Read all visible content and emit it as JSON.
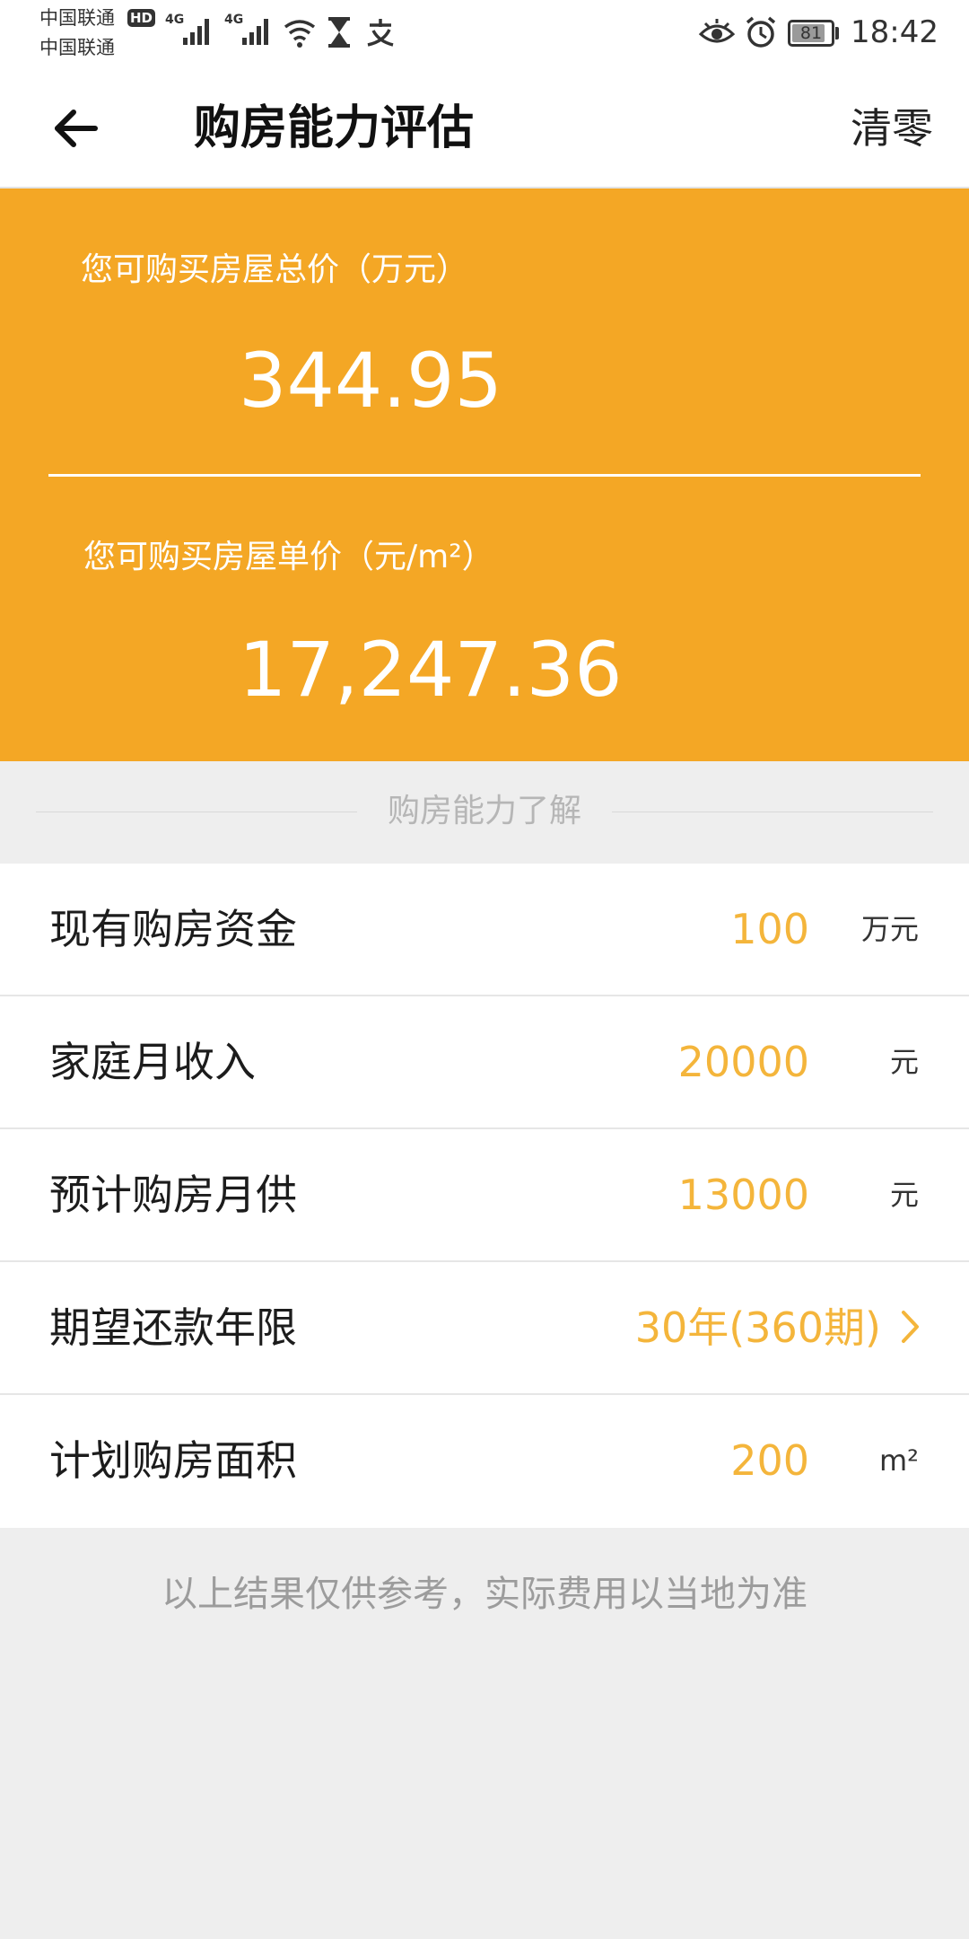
{
  "status_bar": {
    "carrier_1": "中国联通",
    "carrier_2": "中国联通",
    "hd_badge": "HD",
    "network_1": "4G",
    "network_2": "4G",
    "battery_level": "81",
    "time": "18:42"
  },
  "header": {
    "title": "购房能力评估",
    "clear_label": "清零"
  },
  "result": {
    "total_label": "您可购买房屋总价（万元）",
    "total_value": "344.95",
    "unit_label": "您可购买房屋单价（元/m²）",
    "unit_value": "17,247.36"
  },
  "section": {
    "title": "购房能力了解"
  },
  "form": {
    "rows": [
      {
        "label": "现有购房资金",
        "value": "100",
        "unit": "万元"
      },
      {
        "label": "家庭月收入",
        "value": "20000",
        "unit": "元"
      },
      {
        "label": "预计购房月供",
        "value": "13000",
        "unit": "元"
      },
      {
        "label": "期望还款年限",
        "value": "30年(360期)"
      },
      {
        "label": "计划购房面积",
        "value": "200",
        "unit": "m²"
      }
    ]
  },
  "footer": {
    "note": "以上结果仅供参考，实际费用以当地为准"
  },
  "colors": {
    "accent": "#f4a725",
    "value_text": "#f4b53b"
  },
  "icons": {
    "back": "arrow-left-icon",
    "chevron": "chevron-right-icon",
    "wifi": "wifi-icon",
    "hourglass": "hourglass-icon",
    "alipay": "alipay-icon",
    "eye": "eye-icon",
    "alarm": "alarm-icon"
  }
}
